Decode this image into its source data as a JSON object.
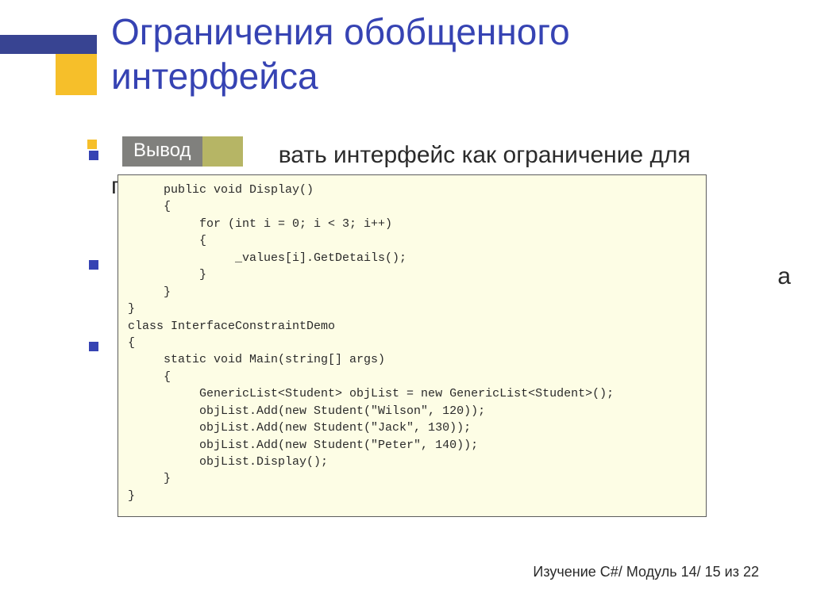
{
  "title": "Ограничения обобщенного интерфейса",
  "tag_label": "Вывод",
  "bullets": {
    "b1_fragment": "вать интерфейс как ограничение для",
    "b1_line2": "параметра типа"
  },
  "stray_char": "а",
  "code": "     public void Display()\n     {\n          for (int i = 0; i < 3; i++)\n          {\n               _values[i].GetDetails();\n          }\n     }\n}\nclass InterfaceConstraintDemo\n{\n     static void Main(string[] args)\n     {\n          GenericList<Student> objList = new GenericList<Student>();\n          objList.Add(new Student(\"Wilson\", 120));\n          objList.Add(new Student(\"Jack\", 130));\n          objList.Add(new Student(\"Peter\", 140));\n          objList.Display();\n     }\n}",
  "footer": "Изучение C#/ Модуль 14/ 15 из 22"
}
